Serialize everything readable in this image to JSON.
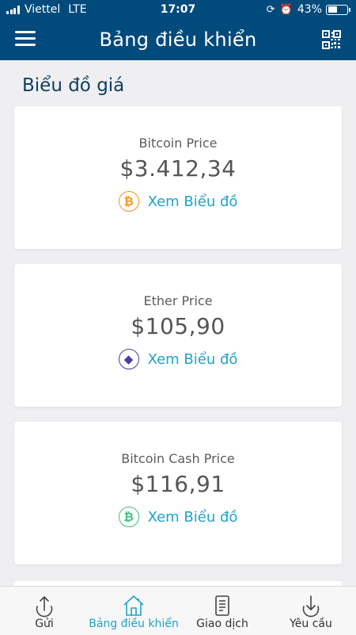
{
  "status_bar": {
    "carrier": "Viettel",
    "network": "LTE",
    "time": "17:07",
    "battery_text": "43%",
    "battery_level": 0.43
  },
  "header": {
    "title": "Bảng điều khiển",
    "menu_icon": "hamburger-menu-icon",
    "qr_icon": "qr-code-icon"
  },
  "section": {
    "title": "Biểu đồ giá"
  },
  "cards": [
    {
      "label": "Bitcoin Price",
      "value": "$3.412,34",
      "link": "Xem Biểu đồ",
      "icon_glyph": "₿",
      "icon": "bitcoin-icon",
      "color": "#f7931a"
    },
    {
      "label": "Ether Price",
      "value": "$105,90",
      "link": "Xem Biểu đồ",
      "icon_glyph": "◆",
      "icon": "ether-icon",
      "color": "#4f3a9c"
    },
    {
      "label": "Bitcoin Cash Price",
      "value": "$116,91",
      "link": "Xem Biểu đồ",
      "icon_glyph": "₿",
      "icon": "bitcoin-cash-icon",
      "color": "#3cc17b"
    }
  ],
  "tabs": [
    {
      "label": "Gửi",
      "icon": "send-icon",
      "active": false
    },
    {
      "label": "Bảng điều khiển",
      "icon": "home-icon",
      "active": true
    },
    {
      "label": "Giao dịch",
      "icon": "transactions-icon",
      "active": false
    },
    {
      "label": "Yêu cầu",
      "icon": "receive-icon",
      "active": false
    }
  ],
  "colors": {
    "header_bg": "#004a7c",
    "accent": "#1fa3c9",
    "section_title": "#0f3f61",
    "page_bg": "#efeff1"
  }
}
